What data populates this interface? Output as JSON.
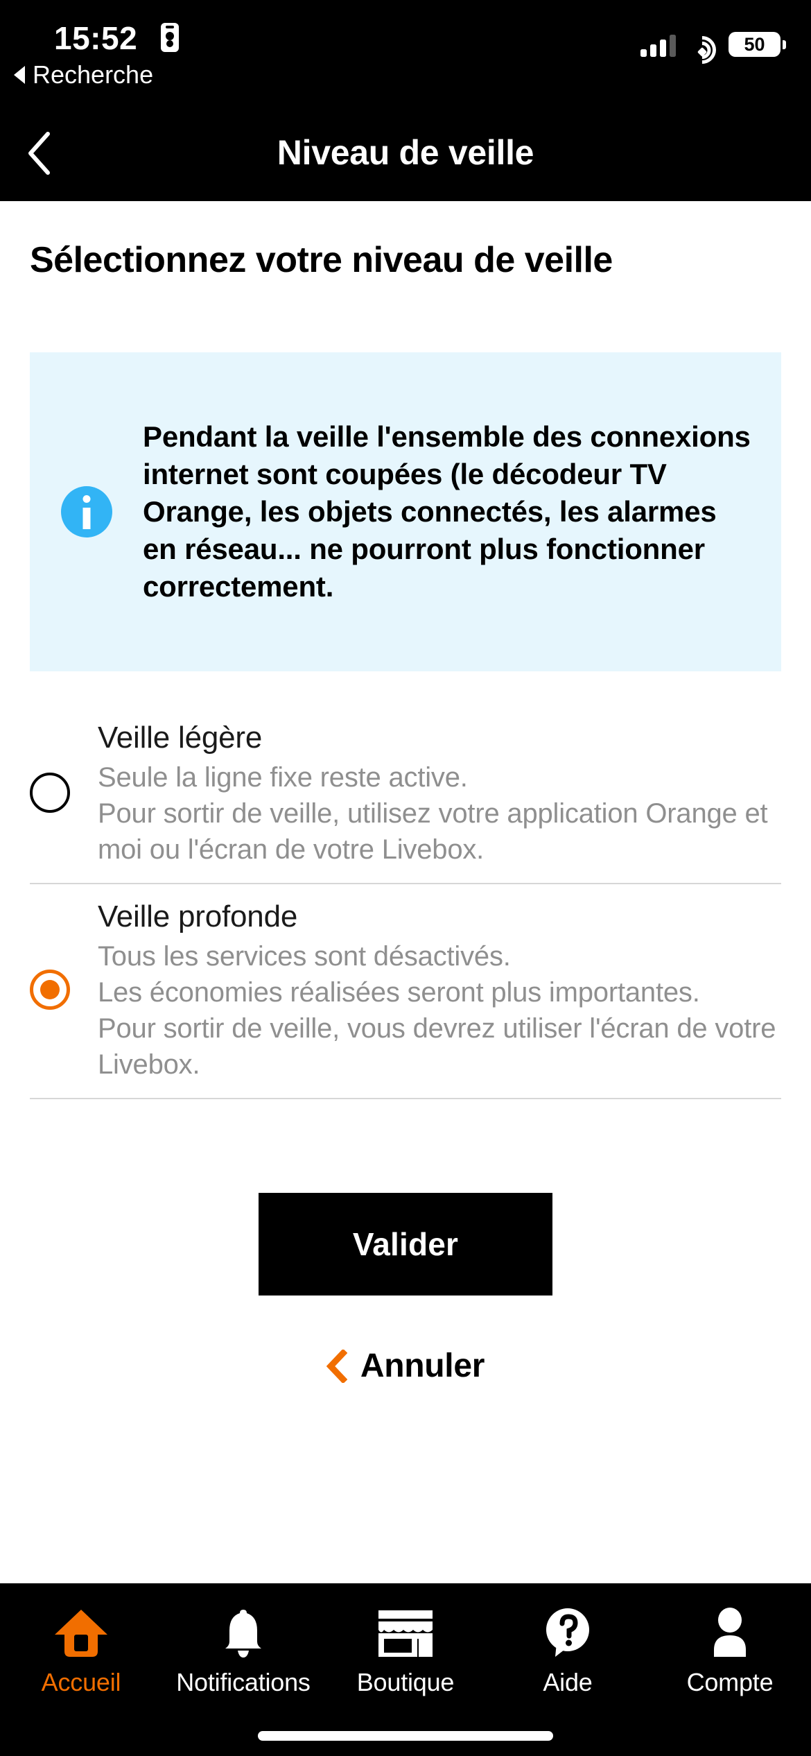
{
  "status_bar": {
    "time": "15:52",
    "recording_icon": "screen-record-icon",
    "back_app_label": "Recherche",
    "signal_icon": "cellular-signal-icon",
    "signal_bars_filled": 3,
    "signal_bars_total": 4,
    "wifi_icon": "wifi-icon",
    "battery_percent": "50"
  },
  "navbar": {
    "back_icon": "chevron-left-icon",
    "title": "Niveau de veille"
  },
  "page": {
    "heading": "Sélectionnez votre niveau de veille"
  },
  "info": {
    "icon": "info-circle-icon",
    "icon_color": "#32b4f5",
    "background_color": "#e6f6fd",
    "text": "Pendant la veille l'ensemble des connexions internet sont coupées (le décodeur TV Orange, les objets connectés, les alarmes en réseau... ne pourront plus fonctionner correctement."
  },
  "options": {
    "selected_index": 1,
    "accent_color": "#f16e00",
    "items": [
      {
        "title": "Veille légère",
        "description": "Seule la ligne fixe reste active.\nPour sortir de veille, utilisez votre application Orange et moi ou l'écran de votre Livebox.",
        "selected": false
      },
      {
        "title": "Veille profonde",
        "description": "Tous les services sont désactivés.\nLes économies réalisées seront plus importantes.\nPour sortir de veille, vous devrez utiliser l'écran de votre Livebox.",
        "selected": true
      }
    ]
  },
  "actions": {
    "submit_label": "Valider",
    "cancel_label": "Annuler",
    "cancel_icon": "chevron-left-icon"
  },
  "tabbar": {
    "active_index": 0,
    "items": [
      {
        "label": "Accueil",
        "icon": "home-icon"
      },
      {
        "label": "Notifications",
        "icon": "bell-icon"
      },
      {
        "label": "Boutique",
        "icon": "shop-icon"
      },
      {
        "label": "Aide",
        "icon": "question-bubble-icon"
      },
      {
        "label": "Compte",
        "icon": "person-icon"
      }
    ]
  }
}
